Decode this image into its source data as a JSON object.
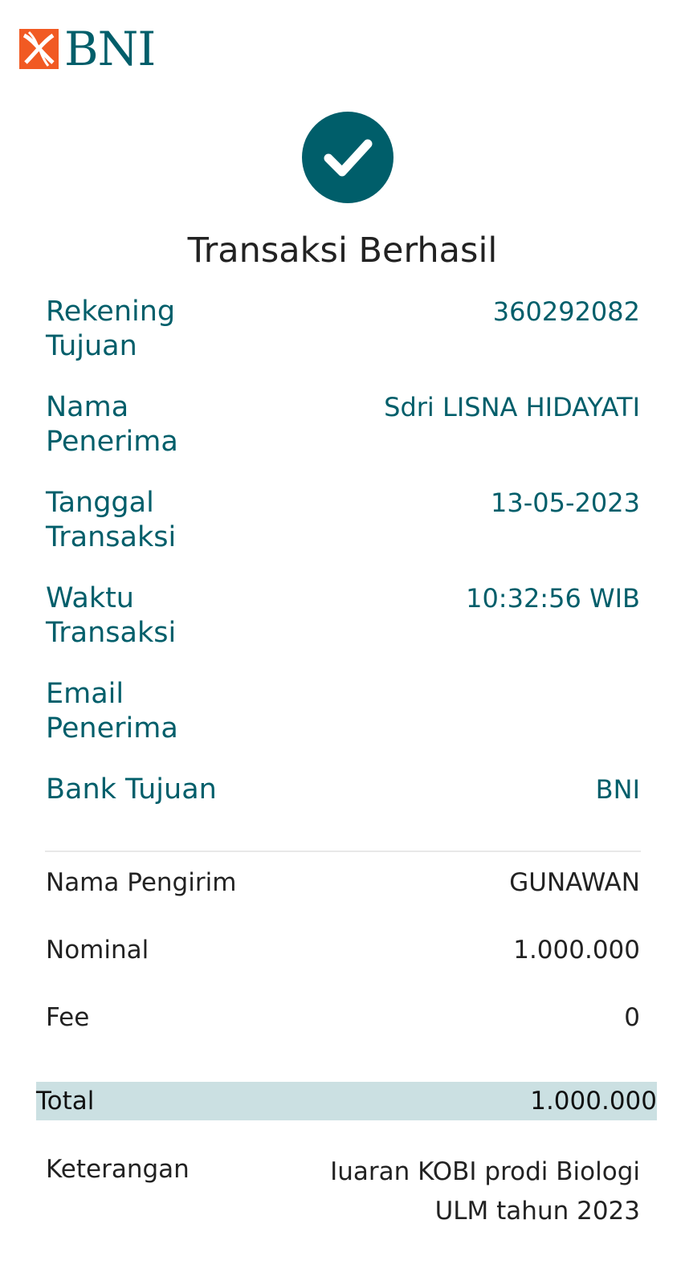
{
  "header": {
    "logo_text": "BNI",
    "logo_icon": "bni-logo-icon",
    "status_icon": "checkmark-icon"
  },
  "title": "Transaksi Berhasil",
  "recipient": {
    "rekening_tujuan": {
      "label": "Rekening Tujuan",
      "value": "360292082"
    },
    "nama_penerima": {
      "label": "Nama Penerima",
      "value": "Sdri LISNA HIDAYATI"
    },
    "tanggal_transaksi": {
      "label": "Tanggal Transaksi",
      "value": "13-05-2023"
    },
    "waktu_transaksi": {
      "label": "Waktu Transaksi",
      "value": "10:32:56 WIB"
    },
    "email_penerima": {
      "label": "Email Penerima",
      "value": ""
    },
    "bank_tujuan": {
      "label": "Bank Tujuan",
      "value": "BNI"
    }
  },
  "sender": {
    "nama_pengirim": {
      "label": "Nama Pengirim",
      "value": "GUNAWAN"
    },
    "nominal": {
      "label": "Nominal",
      "value": "1.000.000"
    },
    "fee": {
      "label": "Fee",
      "value": "0"
    },
    "total": {
      "label": "Total",
      "value": "1.000.000"
    },
    "keterangan": {
      "label": "Keterangan",
      "value": "Iuaran KOBI prodi Biologi ULM tahun 2023"
    }
  },
  "colors": {
    "brand_teal": "#005e6a",
    "brand_orange": "#f15a23",
    "total_highlight": "#cbe0e2",
    "text_dark": "#222222"
  }
}
